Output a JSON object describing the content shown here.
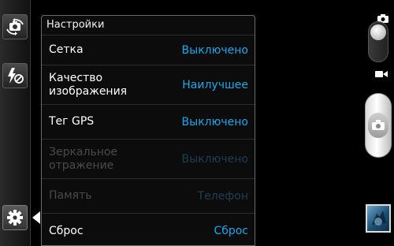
{
  "panel": {
    "title": "Настройки",
    "rows": [
      {
        "label": "Сетка",
        "value": "Выключено",
        "enabled": true
      },
      {
        "label": "Качество изображения",
        "value": "Наилучшее",
        "enabled": true
      },
      {
        "label": "Тег GPS",
        "value": "Выключено",
        "enabled": true
      },
      {
        "label": "Зеркальное отражение",
        "value": "Выключено",
        "enabled": false
      },
      {
        "label": "Память",
        "value": "Телефон",
        "enabled": false
      },
      {
        "label": "Сброс",
        "value": "Сброс",
        "enabled": true
      }
    ]
  },
  "icons": {
    "switch_camera": "switch-camera-icon",
    "flash_off": "flash-off-icon",
    "settings": "gear-icon",
    "photo_mode": "camera-icon",
    "video_mode": "video-camera-icon",
    "shutter": "camera-icon"
  },
  "colors": {
    "value_text": "#1ea7e8",
    "disabled_text": "#4a4a4a",
    "background": "#000000"
  }
}
